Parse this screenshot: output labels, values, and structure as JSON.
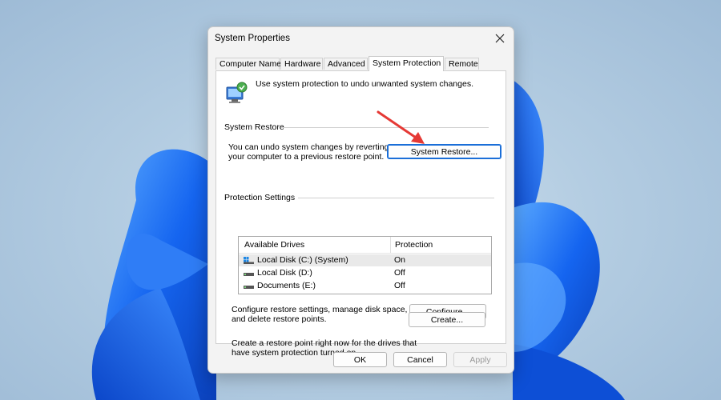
{
  "dialog": {
    "title": "System Properties"
  },
  "tabs": [
    {
      "label": "Computer Name",
      "active": false
    },
    {
      "label": "Hardware",
      "active": false
    },
    {
      "label": "Advanced",
      "active": false
    },
    {
      "label": "System Protection",
      "active": true
    },
    {
      "label": "Remote",
      "active": false
    }
  ],
  "intro": {
    "text": "Use system protection to undo unwanted system changes.",
    "icon": "system-protection-icon"
  },
  "system_restore": {
    "group_title": "System Restore",
    "description_line1": "You can undo system changes by reverting",
    "description_line2": "your computer to a previous restore point.",
    "button_label": "System Restore..."
  },
  "protection_settings": {
    "group_title": "Protection Settings",
    "columns": [
      "Available Drives",
      "Protection"
    ],
    "drives": [
      {
        "name": "Local Disk (C:) (System)",
        "protection": "On",
        "icon": "system-drive-icon",
        "selected": true
      },
      {
        "name": "Local Disk (D:)",
        "protection": "Off",
        "icon": "drive-icon",
        "selected": false
      },
      {
        "name": "Documents (E:)",
        "protection": "Off",
        "icon": "drive-icon",
        "selected": false
      }
    ],
    "configure_text_line1": "Configure restore settings, manage disk space,",
    "configure_text_line2": "and delete restore points.",
    "configure_button": "Configure...",
    "create_text_line1": "Create a restore point right now for the drives that",
    "create_text_line2": "have system protection turned on.",
    "create_button": "Create..."
  },
  "footer": {
    "ok": "OK",
    "cancel": "Cancel",
    "apply": "Apply"
  },
  "colors": {
    "accent": "#1a6ed8",
    "annotation_arrow": "#e53935",
    "wallpaper_blue": "#1560e8"
  }
}
